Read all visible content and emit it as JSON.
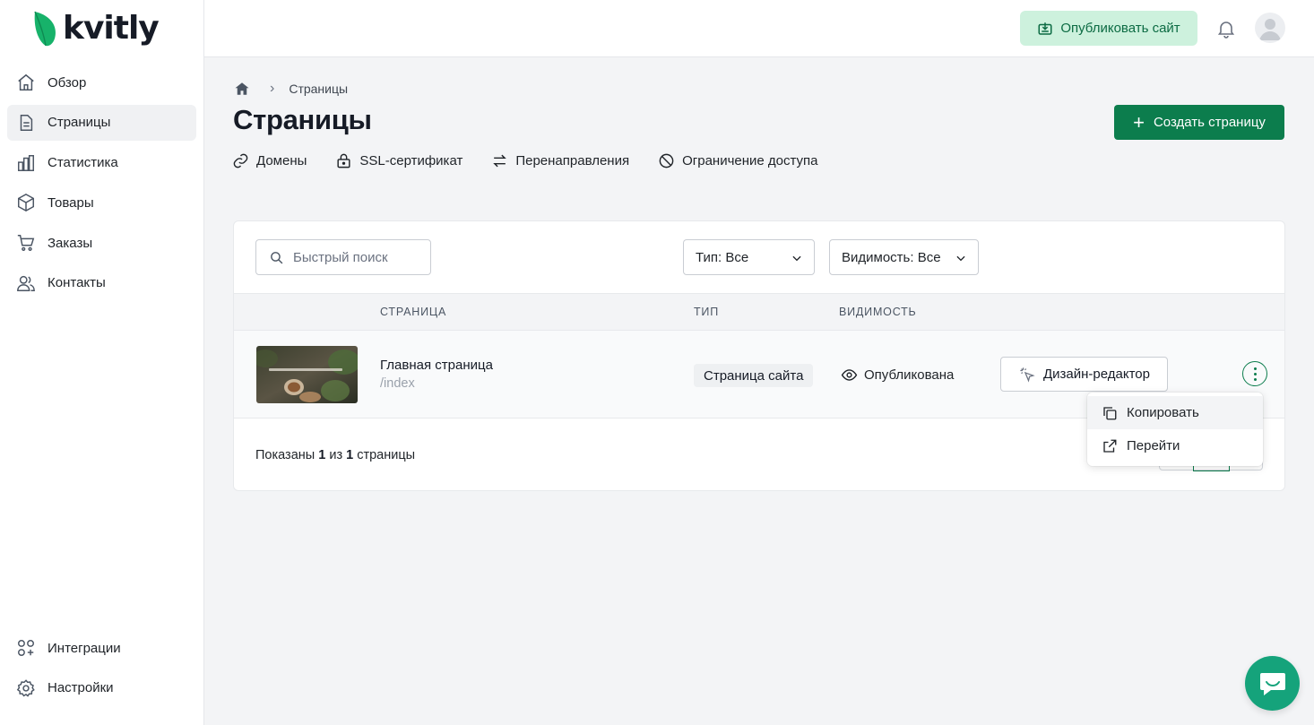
{
  "app": {
    "logo_text": "kvitly",
    "brand_color": "#0c7d4d",
    "logo_leaf_color": "#17b26a"
  },
  "sidebar": {
    "items": [
      {
        "label": "Обзор",
        "icon": "home-icon",
        "active": false
      },
      {
        "label": "Страницы",
        "icon": "document-icon",
        "active": true
      },
      {
        "label": "Статистика",
        "icon": "bar-chart-icon",
        "active": false
      },
      {
        "label": "Товары",
        "icon": "box-icon",
        "active": false
      },
      {
        "label": "Заказы",
        "icon": "cart-icon",
        "active": false
      },
      {
        "label": "Контакты",
        "icon": "users-icon",
        "active": false
      }
    ],
    "bottom_items": [
      {
        "label": "Интеграции",
        "icon": "apps-icon"
      },
      {
        "label": "Настройки",
        "icon": "gear-icon"
      }
    ]
  },
  "topbar": {
    "publish_label": "Опубликовать сайт"
  },
  "breadcrumb": {
    "current": "Страницы"
  },
  "page": {
    "title": "Страницы",
    "create_label": "Создать страницу"
  },
  "subnav": [
    {
      "label": "Домены",
      "icon": "link-icon"
    },
    {
      "label": "SSL-сертификат",
      "icon": "lock-icon"
    },
    {
      "label": "Перенаправления",
      "icon": "arrows-icon"
    },
    {
      "label": "Ограничение доступа",
      "icon": "ban-icon"
    }
  ],
  "filters": {
    "search_placeholder": "Быстрый поиск",
    "type_label": "Тип: Все",
    "visibility_label": "Видимость: Все"
  },
  "table": {
    "columns": [
      "СТРАНИЦА",
      "ТИП",
      "ВИДИМОСТЬ"
    ],
    "rows": [
      {
        "title": "Главная страница",
        "path": "/index",
        "type": "Страница сайта",
        "visibility": "Опубликована",
        "action_label": "Дизайн-редактор"
      }
    ]
  },
  "footer": {
    "prefix": "Показаны ",
    "shown": "1",
    "middle": " из ",
    "total": "1",
    "suffix": " страницы"
  },
  "menu": {
    "items": [
      {
        "label": "Копировать",
        "icon": "copy-icon"
      },
      {
        "label": "Перейти",
        "icon": "external-link-icon"
      }
    ]
  }
}
